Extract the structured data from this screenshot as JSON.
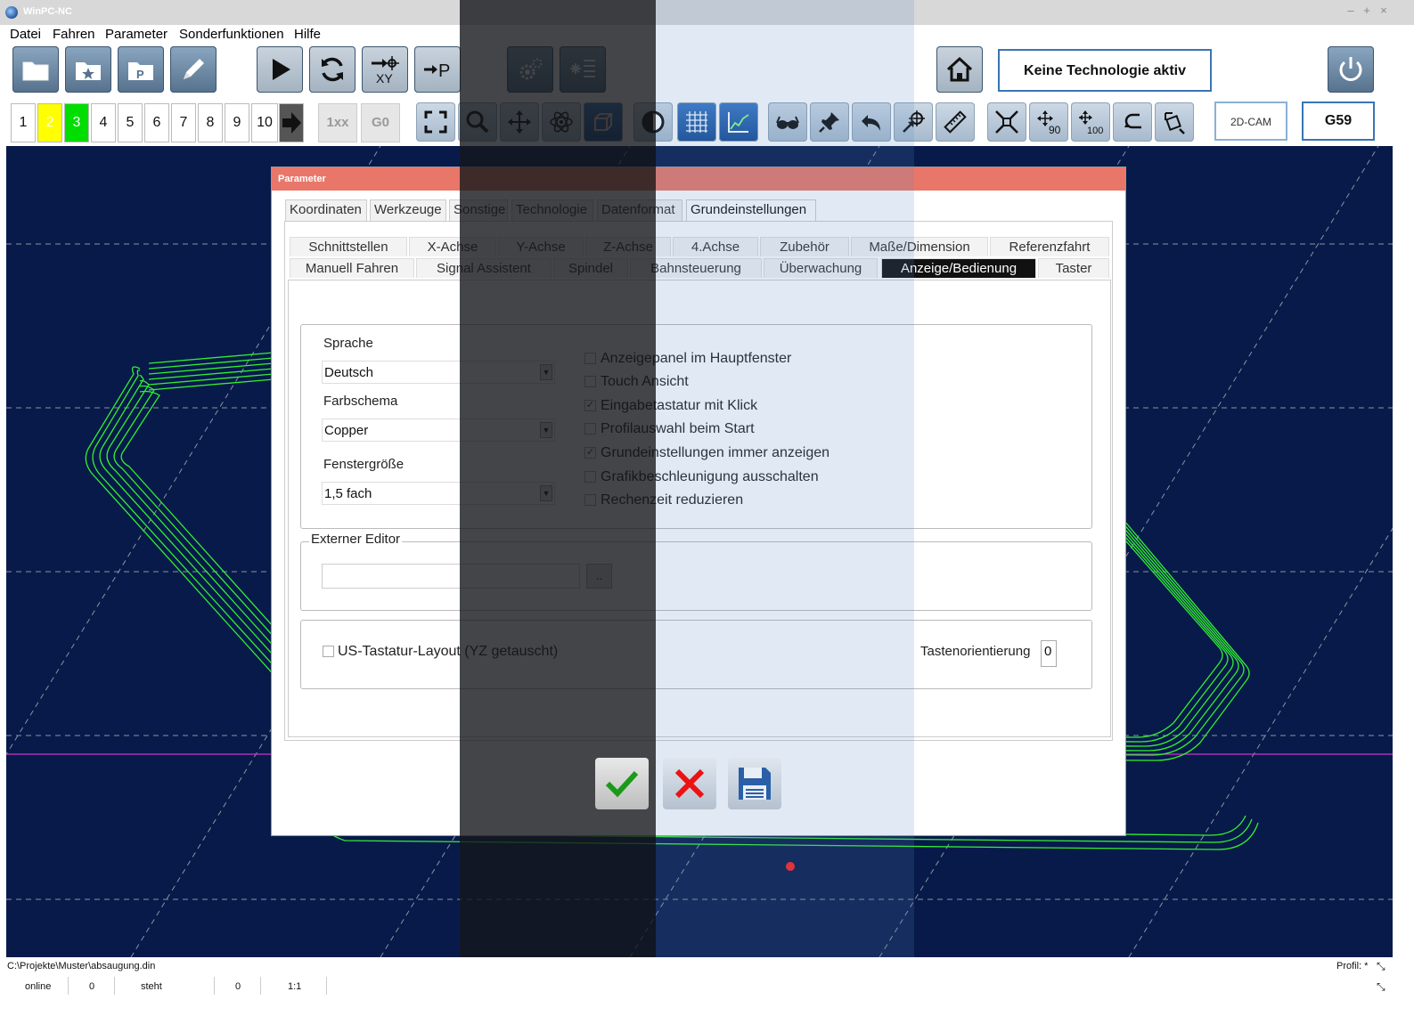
{
  "window": {
    "title": "WinPC-NC",
    "controls": [
      "–",
      "+",
      "×"
    ]
  },
  "menu": [
    "Datei",
    "Fahren",
    "Parameter",
    "Sonderfunktionen",
    "Hilfe"
  ],
  "toolbar": {
    "technology_label": "Keine Technologie aktiv",
    "numbers": [
      "1",
      "2",
      "3",
      "4",
      "5",
      "6",
      "7",
      "8",
      "9",
      "10"
    ],
    "btn_1xx": "1xx",
    "btn_g0": "G0",
    "cam_label": "2D-CAM",
    "g59_label": "G59",
    "move_90": "90",
    "move_100": "100"
  },
  "dialog": {
    "title": "Parameter",
    "main_tabs": [
      "Koordinaten",
      "Werkzeuge",
      "Sonstige",
      "Technologie",
      "Datenformat",
      "Grundeinstellungen"
    ],
    "sub_tabs_row1": [
      "Schnittstellen",
      "X-Achse",
      "Y-Achse",
      "Z-Achse",
      "4.Achse",
      "Zubehör",
      "Maße/Dimension",
      "Referenzfahrt"
    ],
    "sub_tabs_row2": [
      "Manuell Fahren",
      "Signal Assistent",
      "Spindel",
      "Bahnsteuerung",
      "Überwachung",
      "Anzeige/Bedienung",
      "Taster"
    ],
    "sprache_label": "Sprache",
    "sprache_value": "Deutsch",
    "farbschema_label": "Farbschema",
    "farbschema_value": "Copper",
    "fenster_label": "Fenstergröße",
    "fenster_value": "1,5 fach",
    "checkboxes": [
      {
        "label": "Anzeigepanel im Hauptfenster",
        "checked": false
      },
      {
        "label": "Touch Ansicht",
        "checked": false
      },
      {
        "label": "Eingabetastatur mit Klick",
        "checked": true
      },
      {
        "label": "Profilauswahl beim Start",
        "checked": false
      },
      {
        "label": "Grundeinstellungen immer anzeigen",
        "checked": true
      },
      {
        "label": "Grafikbeschleunigung ausschalten",
        "checked": false
      },
      {
        "label": "Rechenzeit reduzieren",
        "checked": false
      }
    ],
    "externer_editor_label": "Externer Editor",
    "editor_value": "",
    "browse_label": "..",
    "us_layout_label": "US-Tastatur-Layout (YZ getauscht)",
    "tastenorientierung_label": "Tastenorientierung",
    "tastenorientierung_value": "0"
  },
  "statusbar": {
    "path": "C:\\Projekte\\Muster\\absaugung.din",
    "profil": "Profil: *",
    "online": "online",
    "val1": "0",
    "state": "steht",
    "val2": "0",
    "scale": "1:1"
  },
  "colors": {
    "canvas_bg": "#071a4a",
    "toolpath": "#33ee33",
    "axis_line": "#cc33cc",
    "title_accent": "#e8776a",
    "color_yellow": "#ffff00",
    "color_green": "#00dd00"
  }
}
